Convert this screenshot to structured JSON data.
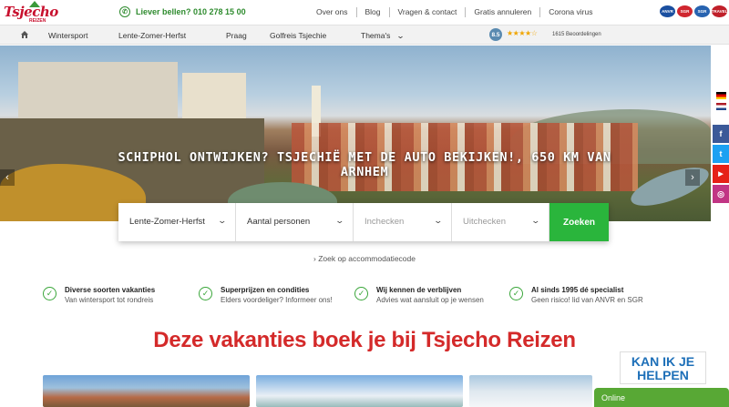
{
  "brand": {
    "logo_text": "Tsjecho",
    "logo_sub": "REIZEN"
  },
  "topbar": {
    "phone_label": "Liever bellen? 010 278 15 00",
    "links": [
      "Over ons",
      "Blog",
      "Vragen & contact",
      "Gratis annuleren",
      "Corona virus"
    ],
    "badges": [
      "ANVR",
      "SGR",
      "SGR",
      "TRAVEL"
    ]
  },
  "nav": {
    "items": [
      "Wintersport",
      "Lente-Zomer-Herfst",
      "Praag",
      "Golfreis Tsjechie",
      "Thema's"
    ],
    "rating_score": "8.5",
    "stars": "★★★★☆",
    "reviews": "1615 Beoordelingen"
  },
  "hero": {
    "title": "SCHIPHOL ONTWIJKEN? TSJECHIË MET DE AUTO BEKIJKEN!, 650 KM VAN ARNHEM",
    "prev": "‹",
    "next": "›"
  },
  "side_social": [
    "f",
    "t",
    "▶",
    "◎"
  ],
  "search": {
    "season_value": "Lente-Zomer-Herfst",
    "persons_label": "Aantal personen",
    "checkin_placeholder": "Inchecken",
    "checkout_placeholder": "Uitchecken",
    "submit_label": "Zoeken",
    "code_link": "› Zoek op accommodatiecode"
  },
  "usps": [
    {
      "title": "Diverse soorten vakanties",
      "sub": "Van wintersport tot rondreis"
    },
    {
      "title": "Superprijzen en condities",
      "sub": "Elders voordeliger? Informeer ons!"
    },
    {
      "title": "Wij kennen de verblijven",
      "sub": "Advies wat aansluit op je wensen"
    },
    {
      "title": "Al sinds 1995 dé specialist",
      "sub": "Geen risico!  lid van ANVR en SGR"
    }
  ],
  "section": {
    "heading": "Deze vakanties boek je bij Tsjecho Reizen"
  },
  "chat": {
    "help": "KAN IK JE HELPEN",
    "status": "Online"
  },
  "colors": {
    "green": "#2ab53c",
    "red": "#d42a2a",
    "blue": "#1d6fb8"
  }
}
